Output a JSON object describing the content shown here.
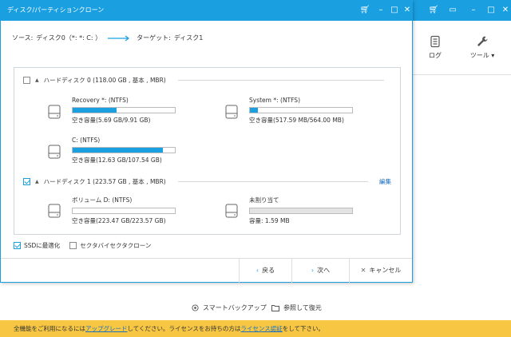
{
  "dialog": {
    "title": "ディスク/パーティションクローン",
    "source_label": "ソース:",
    "source_value": "ディスク0（*: *: C: ）",
    "target_label": "ターゲット:",
    "target_value": "ディスク1"
  },
  "disks": [
    {
      "header": "ハードディスク 0 (118.00 GB , 基本 , MBR)",
      "checked": false,
      "partitions": [
        {
          "name": "Recovery *: (NTFS)",
          "info": "空き容量(5.69 GB/9.91 GB)",
          "used_fraction": 0.43
        },
        {
          "name": "System *: (NTFS)",
          "info": "空き容量(517.59 MB/564.00 MB)",
          "used_fraction": 0.08
        },
        {
          "name": "C: (NTFS)",
          "info": "空き容量(12.63 GB/107.54 GB)",
          "used_fraction": 0.88
        }
      ]
    },
    {
      "header": "ハードディスク 1 (223.57 GB , 基本 , MBR)",
      "checked": true,
      "edit_label": "編集",
      "partitions": [
        {
          "name": "ボリューム D: (NTFS)",
          "info": "空き容量(223.47 GB/223.57 GB)",
          "used_fraction": 0.0
        },
        {
          "name": "未割り当て",
          "info": "容量: 1.59 MB",
          "used_fraction": 0.0
        }
      ]
    }
  ],
  "options": {
    "ssd_label": "SSDに最適化",
    "ssd_checked": true,
    "sector_label": "セクタバイセクタクローン",
    "sector_checked": false
  },
  "footer": {
    "back_label": "戻る",
    "next_label": "次へ",
    "cancel_label": "キャンセル"
  },
  "sidebar": {
    "log_label": "ログ",
    "tools_label": "ツール ▾"
  },
  "bottom": {
    "smart_backup_label": "スマートバックアップ",
    "browse_restore_label": "参照して復元"
  },
  "notice": {
    "text_before": "全機能をご利用になるには",
    "upgrade_link": "アップグレード",
    "text_middle": "してください。ライセンスをお持ちの方は",
    "license_link": "ライセンス認証",
    "text_after": "をして下さい。"
  },
  "colors": {
    "accent": "#1a9fe0",
    "notice_bg": "#f7c744",
    "link": "#1a6fbf"
  }
}
